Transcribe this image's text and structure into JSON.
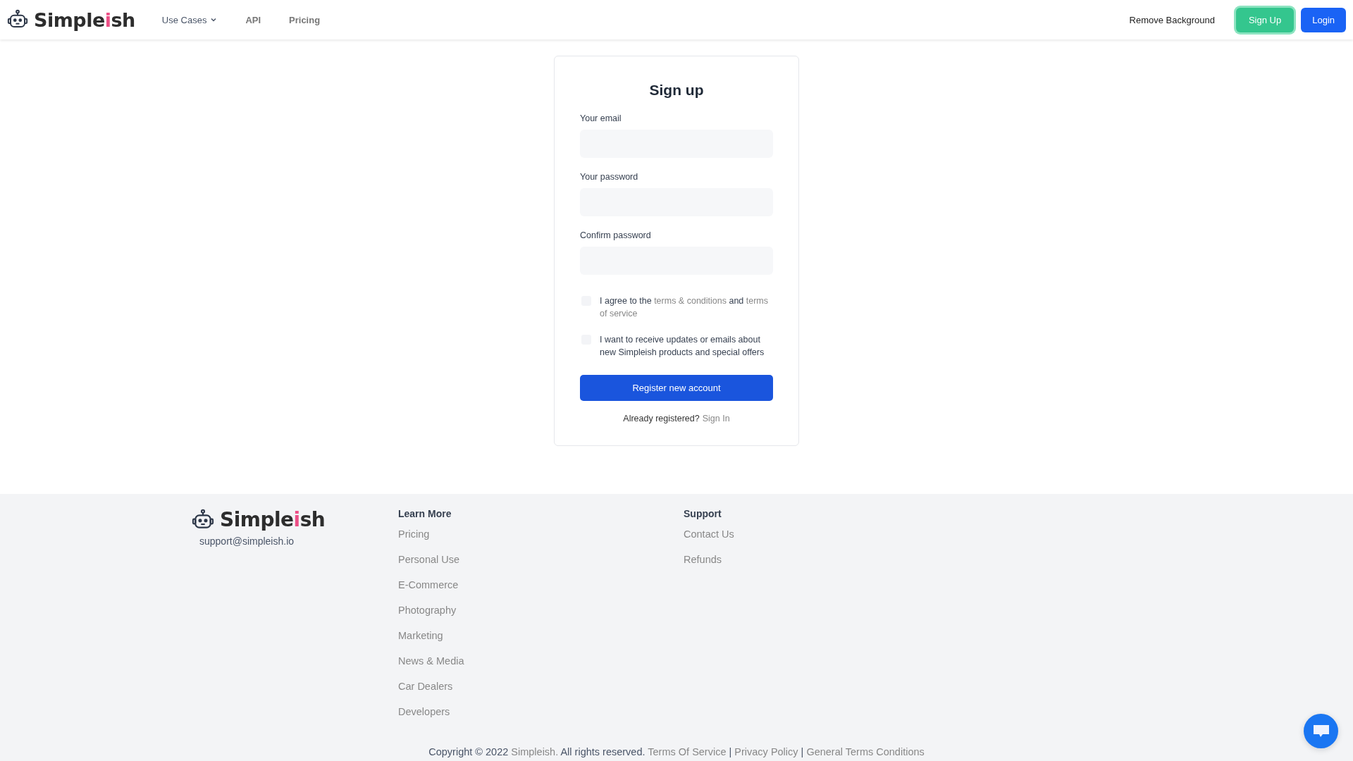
{
  "header": {
    "logo": [
      {
        "text": "Simple",
        "accent": false
      },
      {
        "text": "i",
        "accent": true
      },
      {
        "text": "sh",
        "accent": false
      }
    ],
    "nav": [
      {
        "label": "Use Cases",
        "dropdown": true
      },
      {
        "label": "API",
        "dropdown": false
      },
      {
        "label": "Pricing",
        "dropdown": false
      }
    ],
    "remove_background": "Remove Background",
    "signup_button": "Sign Up",
    "login_button": "Login"
  },
  "form": {
    "title": "Sign up",
    "fields": [
      {
        "label": "Your email"
      },
      {
        "label": "Your password"
      },
      {
        "label": "Confirm password"
      }
    ],
    "checkboxes": [
      {
        "checked": false,
        "parts": [
          {
            "kind": "text",
            "text": "I agree to the "
          },
          {
            "kind": "link",
            "text": "terms & conditions"
          },
          {
            "kind": "text",
            "text": " and "
          },
          {
            "kind": "link",
            "text": "terms of service"
          }
        ]
      },
      {
        "checked": false,
        "parts": [
          {
            "kind": "text",
            "text": "I want to receive updates or emails about new Simpleish products and special offers"
          }
        ]
      }
    ],
    "submit": "Register new account",
    "already": "Already registered?",
    "signin": "Sign In"
  },
  "footer": {
    "logo": [
      {
        "text": "Simple",
        "accent": false
      },
      {
        "text": "i",
        "accent": true
      },
      {
        "text": "sh",
        "accent": false
      }
    ],
    "email": "support@simpleish.io",
    "columns": [
      {
        "heading": "Learn More",
        "links": [
          "Pricing",
          "Personal Use",
          "E-Commerce",
          "Photography",
          "Marketing",
          "News & Media",
          "Car Dealers",
          "Developers"
        ]
      },
      {
        "heading": "Support",
        "links": [
          "Contact Us",
          "Refunds"
        ]
      }
    ],
    "copyright": [
      {
        "kind": "text",
        "text": "Copyright © 2022 "
      },
      {
        "kind": "link",
        "text": "Simpleish."
      },
      {
        "kind": "text",
        "text": " All rights reserved. "
      },
      {
        "kind": "link",
        "text": "Terms Of Service"
      },
      {
        "kind": "text",
        "text": " | "
      },
      {
        "kind": "link",
        "text": "Privacy Policy"
      },
      {
        "kind": "text",
        "text": " | "
      },
      {
        "kind": "link",
        "text": "General Terms Conditions"
      }
    ]
  }
}
